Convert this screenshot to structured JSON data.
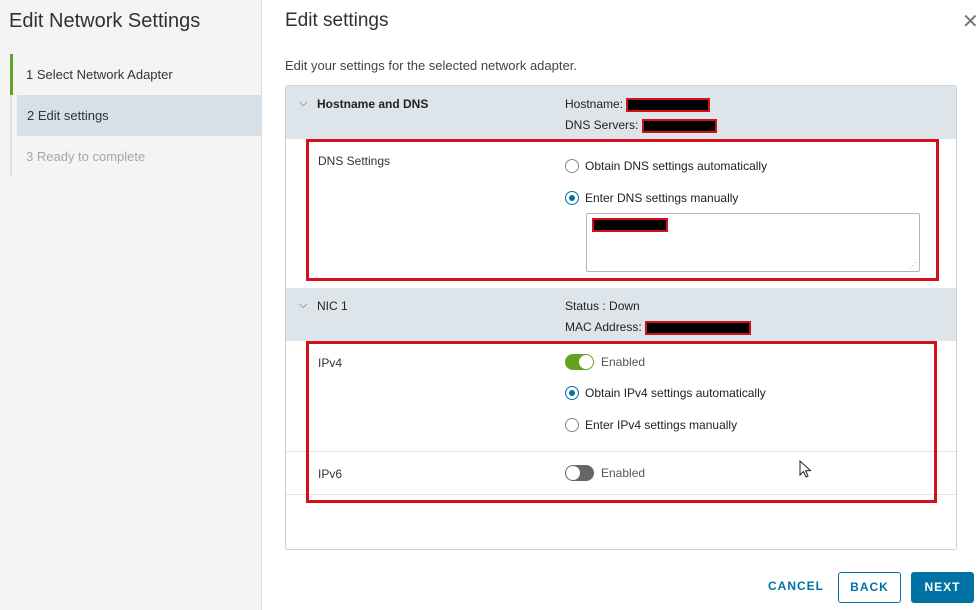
{
  "wizard": {
    "title": "Edit Network Settings",
    "steps": [
      {
        "number": "1",
        "label": "Select Network Adapter"
      },
      {
        "number": "2",
        "label": "Edit settings"
      },
      {
        "number": "3",
        "label": "Ready to complete"
      }
    ]
  },
  "main": {
    "title": "Edit settings",
    "subtitle": "Edit your settings for the selected network adapter."
  },
  "hostname_dns": {
    "section_label": "Hostname and DNS",
    "hostname_label": "Hostname:",
    "dns_servers_label": "DNS Servers:",
    "dns_settings_label": "DNS Settings",
    "option_auto": "Obtain DNS settings automatically",
    "option_manual": "Enter DNS settings manually",
    "selected": "manual"
  },
  "nic1": {
    "section_label": "NIC 1",
    "status": "Status : Down",
    "mac_label": "MAC Address:",
    "ipv4_label": "IPv4",
    "ipv4_toggle_label": "Enabled",
    "ipv4_enabled": true,
    "ipv4_option_auto": "Obtain IPv4 settings automatically",
    "ipv4_option_manual": "Enter IPv4 settings manually",
    "ipv4_selected": "auto",
    "ipv6_label": "IPv6",
    "ipv6_toggle_label": "Enabled",
    "ipv6_enabled": false
  },
  "footer": {
    "cancel_label": "CANCEL",
    "back_label": "BACK",
    "next_label": "NEXT"
  },
  "colors": {
    "accent": "#0072a3",
    "toggle_on": "#62a420",
    "highlight": "#d3111d",
    "section_bg": "#dde5ea"
  }
}
